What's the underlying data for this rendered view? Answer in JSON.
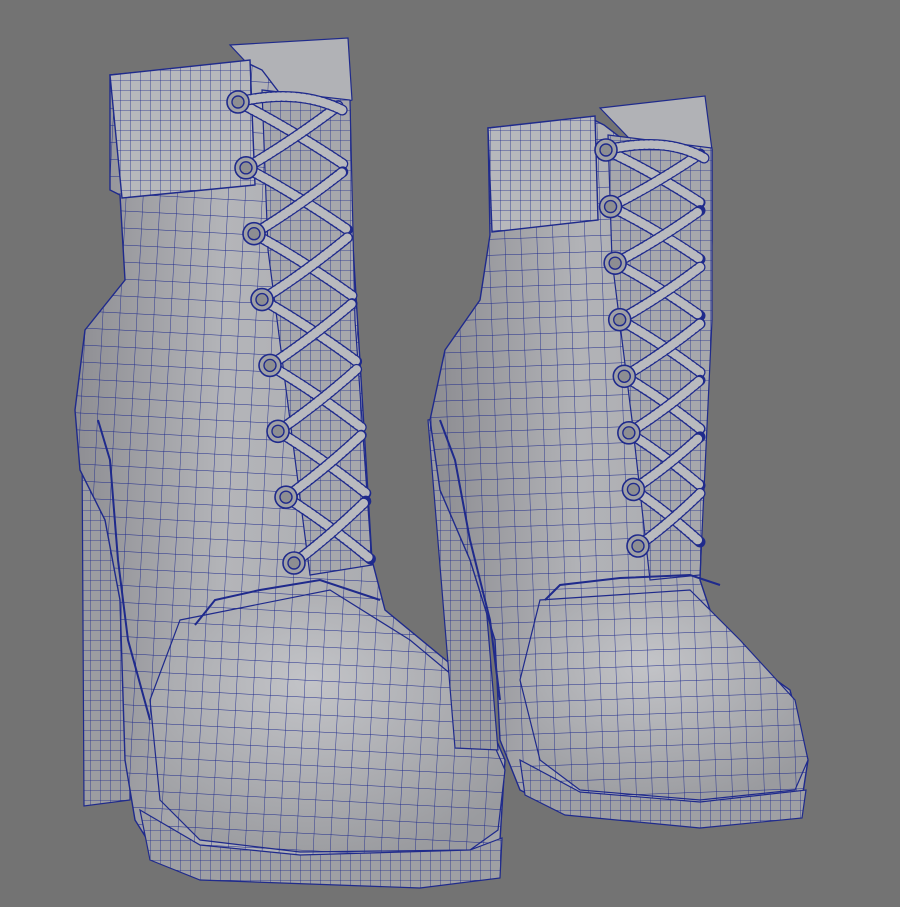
{
  "viewport": {
    "background": "#737373",
    "surface_color": "#a9a9ad",
    "surface_shadow": "#8e8e93",
    "surface_highlight": "#bfc0c4",
    "wire_color": "#1f2a8c",
    "display_mode": "wireframe-on-shaded"
  },
  "objects": [
    {
      "name": "boot_left",
      "type": "high-heel-lace-up-ankle-boot",
      "eyelets": 8
    },
    {
      "name": "boot_right",
      "type": "high-heel-lace-up-ankle-boot",
      "eyelets": 8
    }
  ]
}
